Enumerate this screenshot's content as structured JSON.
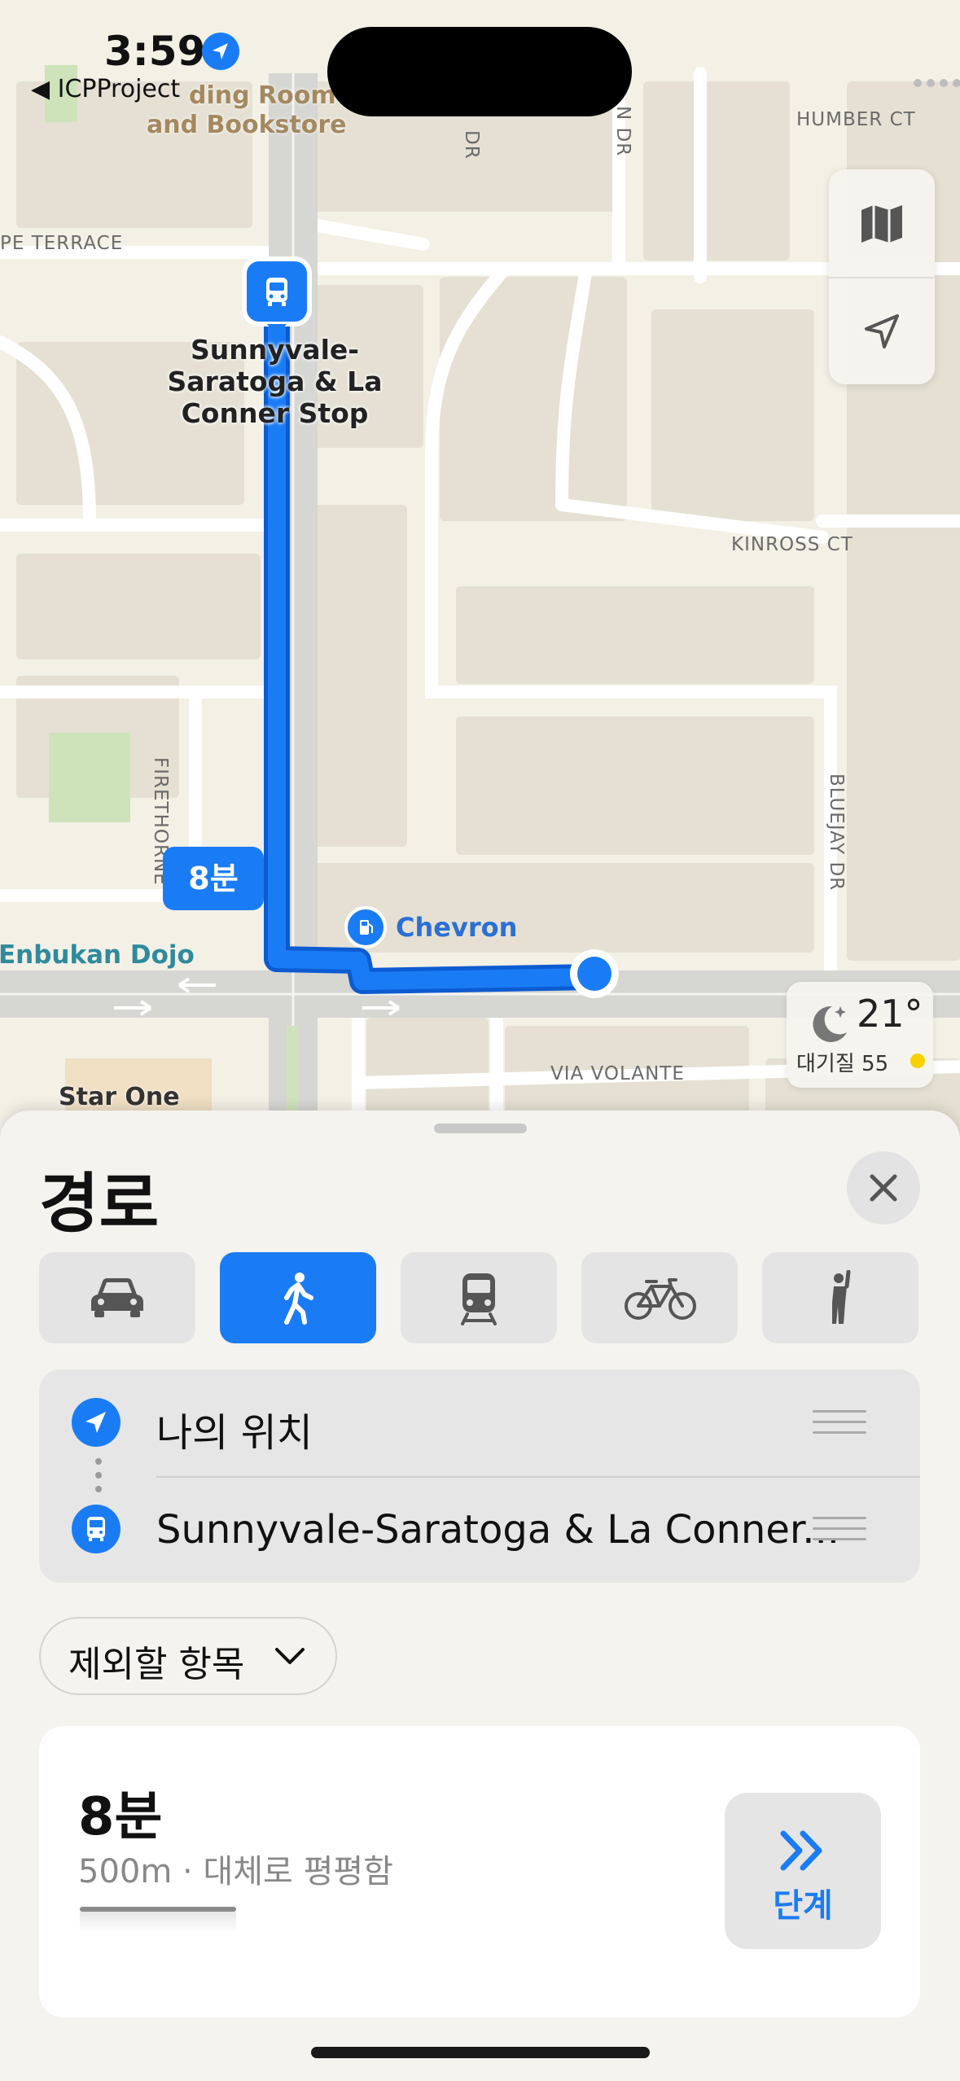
{
  "status_bar": {
    "time": "3:59",
    "back_app": "ICPProject"
  },
  "map": {
    "labels": {
      "bookstore_line1": "ding Room",
      "bookstore_line2": "and Bookstore",
      "humber": "HUMBER CT",
      "terrace": "PE TERRACE",
      "kinross": "KINROSS CT",
      "firethorne": "FIRETHORNE",
      "bluejay": "BLUEJAY DR",
      "via_volante": "VIA VOLANTE",
      "dr1": "DR",
      "dr2": "N DR"
    },
    "stop_label": "Sunnyvale-Saratoga & La Conner Stop",
    "time_badge": "8분",
    "chevron": "Chevron",
    "dojo": "Enbukan Dojo",
    "star_one": "Star One",
    "weather": {
      "temp": "21°",
      "aqi_label": "대기질 55"
    },
    "colors": {
      "route": "#1a7cf5",
      "land": "#f3f0e6",
      "building": "#e4dfd2",
      "park": "#cde3b8"
    }
  },
  "sheet": {
    "title": "경로",
    "modes": [
      {
        "name": "drive",
        "icon": "car-icon",
        "active": false
      },
      {
        "name": "walk",
        "icon": "walking-icon",
        "active": true
      },
      {
        "name": "transit",
        "icon": "train-icon",
        "active": false
      },
      {
        "name": "cycle",
        "icon": "bicycle-icon",
        "active": false
      },
      {
        "name": "rideshare",
        "icon": "hail-icon",
        "active": false
      }
    ],
    "origin": "나의 위치",
    "destination": "Sunnyvale-Saratoga & La Conner...",
    "avoid_label": "제외할 항목",
    "route": {
      "duration": "8분",
      "details": "500m · 대체로 평평함",
      "steps_label": "단계"
    }
  }
}
